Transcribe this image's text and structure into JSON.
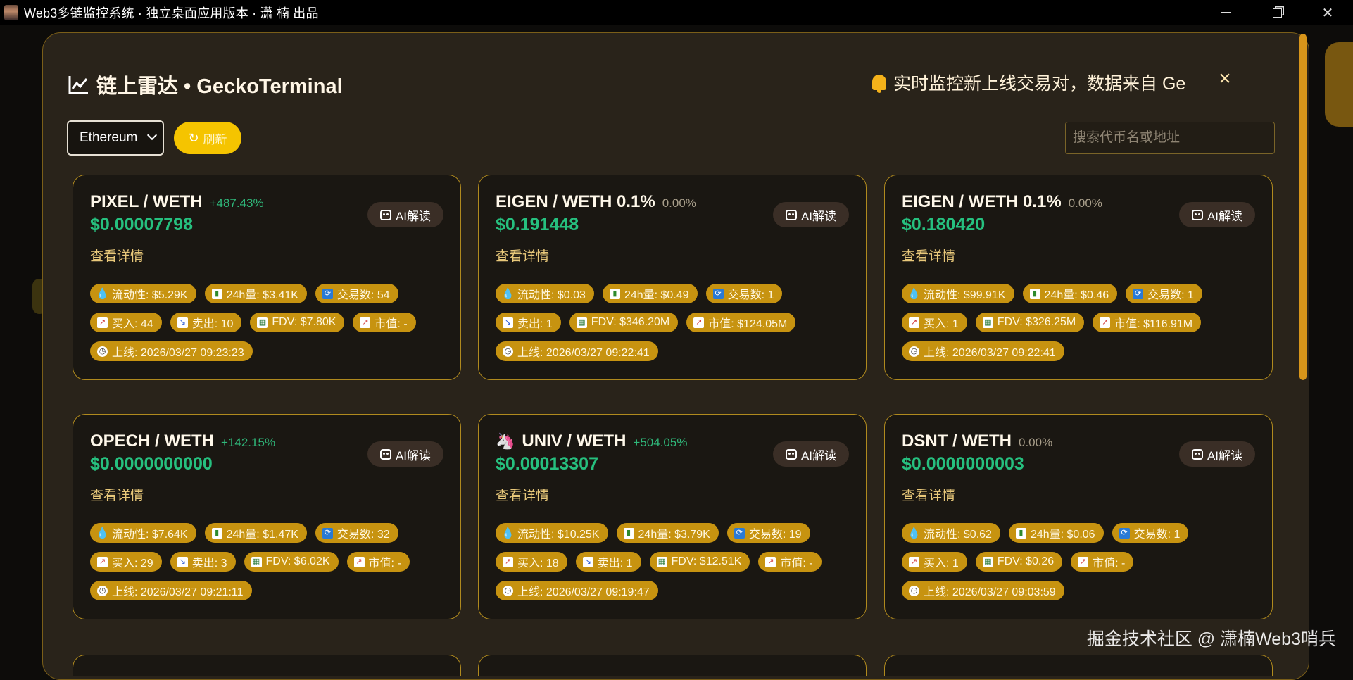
{
  "window": {
    "title": "Web3多链监控系统 · 独立桌面应用版本 · 潇 楠 出品"
  },
  "modal": {
    "title": "链上雷达 • GeckoTerminal",
    "notice": "实时监控新上线交易对，数据来自 Ge",
    "close": "×"
  },
  "toolbar": {
    "chain_selected": "Ethereum",
    "refresh_label": "刷新",
    "search_placeholder": "搜索代币名或地址"
  },
  "labels": {
    "ai_button": "AI解读",
    "view_detail": "查看详情"
  },
  "cards": [
    {
      "pair": "PIXEL / WETH",
      "change": "+487.43%",
      "price": "$0.00007798",
      "tags": [
        {
          "icon": "droplet-icon",
          "text": "流动性: $5.29K"
        },
        {
          "icon": "bar-chart-icon",
          "text": "24h量: $3.41K"
        },
        {
          "icon": "swap-icon",
          "text": "交易数: 54"
        },
        {
          "icon": "trend-up-icon",
          "text": "买入: 44"
        },
        {
          "icon": "trend-down-icon",
          "text": "卖出: 10"
        },
        {
          "icon": "building-icon",
          "text": "FDV: $7.80K"
        },
        {
          "icon": "trend-up-icon",
          "text": "市值: -"
        },
        {
          "icon": "clock-icon",
          "text": "上线: 2026/03/27 09:23:23"
        }
      ]
    },
    {
      "pair": "EIGEN / WETH 0.1%",
      "change": "0.00%",
      "price": "$0.191448",
      "tags": [
        {
          "icon": "droplet-icon",
          "text": "流动性: $0.03"
        },
        {
          "icon": "bar-chart-icon",
          "text": "24h量: $0.49"
        },
        {
          "icon": "swap-icon",
          "text": "交易数: 1"
        },
        {
          "icon": "trend-down-icon",
          "text": "卖出: 1"
        },
        {
          "icon": "building-icon",
          "text": "FDV: $346.20M"
        },
        {
          "icon": "trend-up-icon",
          "text": "市值: $124.05M"
        },
        {
          "icon": "clock-icon",
          "text": "上线: 2026/03/27 09:22:41"
        }
      ]
    },
    {
      "pair": "EIGEN / WETH 0.1%",
      "change": "0.00%",
      "price": "$0.180420",
      "tags": [
        {
          "icon": "droplet-icon",
          "text": "流动性: $99.91K"
        },
        {
          "icon": "bar-chart-icon",
          "text": "24h量: $0.46"
        },
        {
          "icon": "swap-icon",
          "text": "交易数: 1"
        },
        {
          "icon": "trend-up-icon",
          "text": "买入: 1"
        },
        {
          "icon": "building-icon",
          "text": "FDV: $326.25M"
        },
        {
          "icon": "trend-up-icon",
          "text": "市值: $116.91M"
        },
        {
          "icon": "clock-icon",
          "text": "上线: 2026/03/27 09:22:41"
        }
      ]
    },
    {
      "pair": "OPECH / WETH",
      "change": "+142.15%",
      "price": "$0.0000000000",
      "tags": [
        {
          "icon": "droplet-icon",
          "text": "流动性: $7.64K"
        },
        {
          "icon": "bar-chart-icon",
          "text": "24h量: $1.47K"
        },
        {
          "icon": "swap-icon",
          "text": "交易数: 32"
        },
        {
          "icon": "trend-up-icon",
          "text": "买入: 29"
        },
        {
          "icon": "trend-down-icon",
          "text": "卖出: 3"
        },
        {
          "icon": "building-icon",
          "text": "FDV: $6.02K"
        },
        {
          "icon": "trend-up-icon",
          "text": "市值: -"
        },
        {
          "icon": "clock-icon",
          "text": "上线: 2026/03/27 09:21:11"
        }
      ]
    },
    {
      "pair": "UNIV / WETH",
      "change": "+504.05%",
      "price": "$0.00013307",
      "logo": "🦄",
      "tags": [
        {
          "icon": "droplet-icon",
          "text": "流动性: $10.25K"
        },
        {
          "icon": "bar-chart-icon",
          "text": "24h量: $3.79K"
        },
        {
          "icon": "swap-icon",
          "text": "交易数: 19"
        },
        {
          "icon": "trend-up-icon",
          "text": "买入: 18"
        },
        {
          "icon": "trend-down-icon",
          "text": "卖出: 1"
        },
        {
          "icon": "building-icon",
          "text": "FDV: $12.51K"
        },
        {
          "icon": "trend-up-icon",
          "text": "市值: -"
        },
        {
          "icon": "clock-icon",
          "text": "上线: 2026/03/27 09:19:47"
        }
      ]
    },
    {
      "pair": "DSNT / WETH",
      "change": "0.00%",
      "price": "$0.0000000003",
      "tags": [
        {
          "icon": "droplet-icon",
          "text": "流动性: $0.62"
        },
        {
          "icon": "bar-chart-icon",
          "text": "24h量: $0.06"
        },
        {
          "icon": "swap-icon",
          "text": "交易数: 1"
        },
        {
          "icon": "trend-up-icon",
          "text": "买入: 1"
        },
        {
          "icon": "building-icon",
          "text": "FDV: $0.26"
        },
        {
          "icon": "trend-up-icon",
          "text": "市值: -"
        },
        {
          "icon": "clock-icon",
          "text": "上线: 2026/03/27 09:03:59"
        }
      ]
    }
  ],
  "watermark": "掘金技术社区 @ 潇楠Web3哨兵",
  "colors": {
    "accent": "#c79310",
    "positive": "#26c07f",
    "card_border": "#b08a1e",
    "refresh_button": "#f5c400"
  }
}
